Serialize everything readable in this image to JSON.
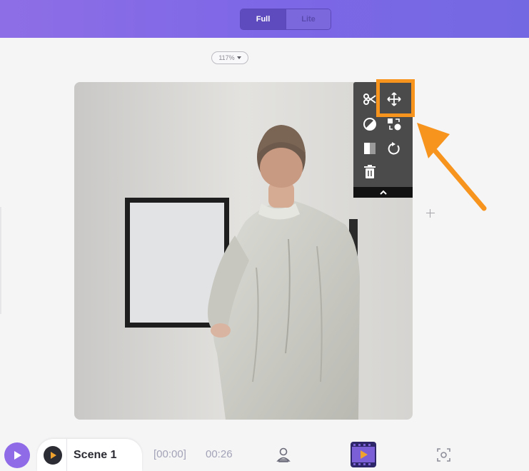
{
  "header": {
    "mode_toggle": {
      "full_label": "Full",
      "lite_label": "Lite",
      "selected": "Full"
    }
  },
  "canvas": {
    "zoom_label": "117%",
    "image_alt": "Man in white shirt facing a wall with an empty picture frame"
  },
  "toolbar": {
    "tools": [
      {
        "name": "cut",
        "icon": "scissors-icon"
      },
      {
        "name": "move",
        "icon": "move-arrows-icon",
        "highlighted": true
      },
      {
        "name": "adjust",
        "icon": "contrast-icon"
      },
      {
        "name": "replace",
        "icon": "swap-shapes-icon"
      },
      {
        "name": "flip",
        "icon": "flip-icon"
      },
      {
        "name": "rotate",
        "icon": "rotate-icon"
      },
      {
        "name": "delete",
        "icon": "trash-icon"
      }
    ],
    "collapse_icon": "chevron-up-icon"
  },
  "timeline": {
    "scene_label": "Scene 1",
    "time_start": "[00:00]",
    "time_total": "00:26"
  },
  "colors": {
    "accent": "#8f6be8",
    "highlight": "#f7941d",
    "toolbar_bg": "#4b4b4b"
  }
}
